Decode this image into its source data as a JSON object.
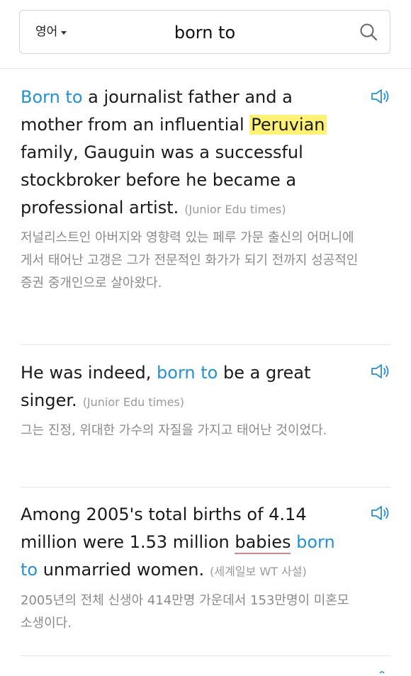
{
  "search": {
    "language_label": "영어",
    "query": "born to",
    "search_icon": "search-icon"
  },
  "entries": [
    {
      "parts": [
        {
          "text": "Born to",
          "style": "keyword"
        },
        {
          "text": " a journalist father and a mother from an influential ",
          "style": "plain"
        },
        {
          "text": "Peruvian",
          "style": "highlight"
        },
        {
          "text": " family, Gauguin was a successful stockbroker before he became a professional artist.",
          "style": "plain"
        }
      ],
      "source": "(Junior Edu times)",
      "translation": "저널리스트인 아버지와 영향력 있는 페루 가문 출신의 어머니에게서 태어난 고갱은 그가 전문적인 화가가 되기 전까지 성공적인 증권 중개인으로 살아왔다.",
      "audio_icon": "speaker-icon"
    },
    {
      "parts": [
        {
          "text": "He was indeed, ",
          "style": "plain"
        },
        {
          "text": "born to",
          "style": "keyword"
        },
        {
          "text": " be a great singer.",
          "style": "plain"
        }
      ],
      "source": "(Junior Edu times)",
      "translation": "그는 진정, 위대한 가수의 자질을 가지고 태어난 것이었다.",
      "audio_icon": "speaker-icon"
    },
    {
      "parts": [
        {
          "text": "Among 2005's total births of 4.14 million were 1.53 million ",
          "style": "plain"
        },
        {
          "text": "babies",
          "style": "underline"
        },
        {
          "text": " ",
          "style": "plain"
        },
        {
          "text": "born to",
          "style": "keyword"
        },
        {
          "text": " unmarried women.",
          "style": "plain"
        }
      ],
      "source": "(세계일보 WT 사설)",
      "translation": "2005년의 전체 신생아 414만명 가운데서 153만명이 미혼모 소생이다.",
      "audio_icon": "speaker-icon"
    }
  ]
}
